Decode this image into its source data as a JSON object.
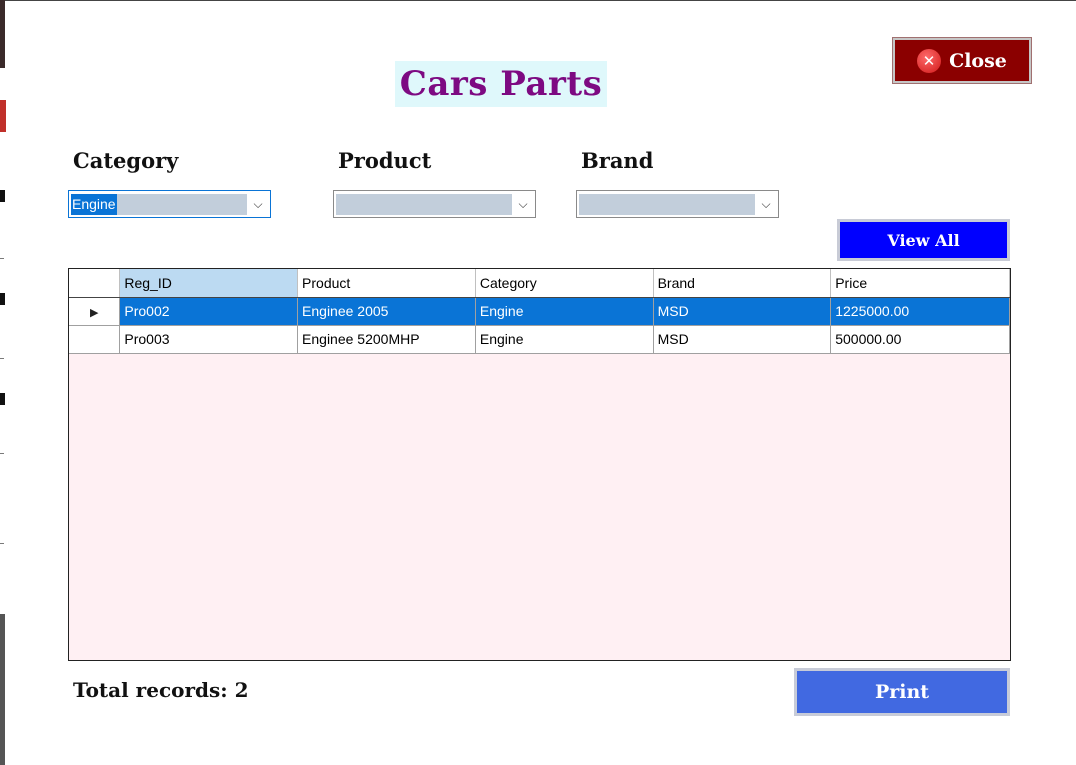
{
  "window": {
    "title": "Cars Parts"
  },
  "buttons": {
    "close": "Close",
    "view_all": "View All",
    "print": "Print"
  },
  "filters": {
    "category": {
      "label": "Category",
      "value": "Engine"
    },
    "product": {
      "label": "Product",
      "value": ""
    },
    "brand": {
      "label": "Brand",
      "value": ""
    }
  },
  "grid": {
    "columns": [
      "Reg_ID",
      "Product",
      "Category",
      "Brand",
      "Price"
    ],
    "rows": [
      [
        "Pro002",
        "Enginee 2005",
        "Engine",
        "MSD",
        "1225000.00"
      ],
      [
        "Pro003",
        "Enginee 5200MHP",
        "Engine",
        "MSD",
        "500000.00"
      ]
    ]
  },
  "footer": {
    "total_records": "Total records: 2"
  },
  "colors": {
    "title_text": "#7d0a82",
    "title_bg": "#dff8fb",
    "close_bg": "#8b0000",
    "view_all_bg": "#0000ff",
    "print_bg": "#4169e1",
    "selection": "#0a74d6",
    "grid_bg": "#fff0f3"
  },
  "icons": {
    "close": "close-icon",
    "dropdown": "chevron-down-icon",
    "row_pointer": "row-pointer-icon"
  }
}
